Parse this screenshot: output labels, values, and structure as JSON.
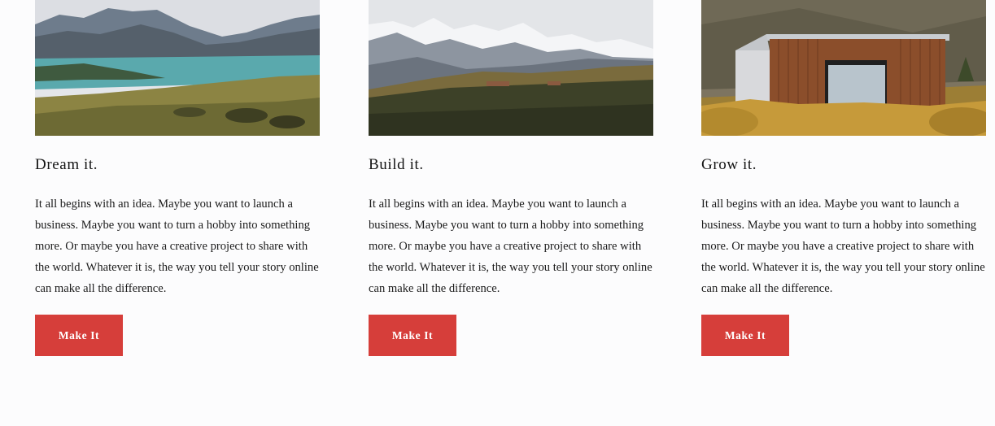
{
  "cards": [
    {
      "image": "lake-mountain-landscape-photo",
      "title": "Dream it.",
      "body": "It all begins with an idea. Maybe you want to launch a business. Maybe you want to turn a hobby into something more. Or maybe you have a creative project to share with the world. Whatever it is, the way you tell your story online can make all the difference.",
      "button": "Make It"
    },
    {
      "image": "snowy-mountains-photo",
      "title": "Build it.",
      "body": "It all begins with an idea. Maybe you want to launch a business. Maybe you want to turn a hobby into something more. Or maybe you have a creative project to share with the world. Whatever it is, the way you tell your story online can make all the difference.",
      "button": "Make It"
    },
    {
      "image": "wooden-cabin-photo",
      "title": "Grow it.",
      "body": "It all begins with an idea. Maybe you want to launch a business. Maybe you want to turn a hobby into something more. Or maybe you have a creative project to share with the world. Whatever it is, the way you tell your story online can make all the difference.",
      "button": "Make It"
    }
  ],
  "colors": {
    "button": "#d63e3a",
    "background": "#fcfcfd",
    "text": "#141414"
  }
}
